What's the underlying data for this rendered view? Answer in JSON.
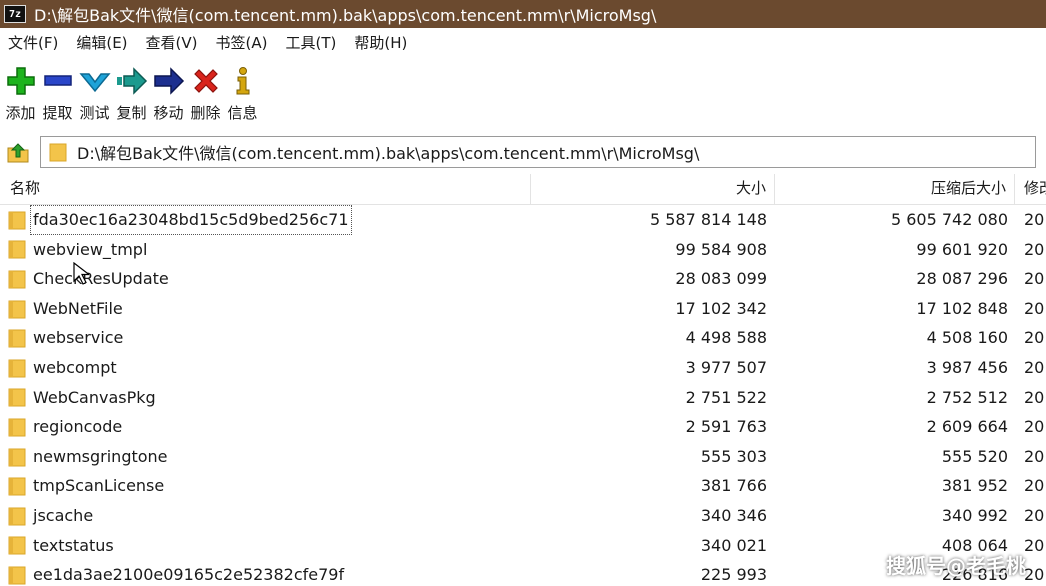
{
  "window": {
    "app_icon_text": "7z",
    "title": "D:\\解包Bak文件\\微信(com.tencent.mm).bak\\apps\\com.tencent.mm\\r\\MicroMsg\\"
  },
  "menu": [
    {
      "label": "文件(F)"
    },
    {
      "label": "编辑(E)"
    },
    {
      "label": "查看(V)"
    },
    {
      "label": "书签(A)"
    },
    {
      "label": "工具(T)"
    },
    {
      "label": "帮助(H)"
    }
  ],
  "toolbar": [
    {
      "label": "添加",
      "icon": "plus-icon",
      "color": "#1db31d"
    },
    {
      "label": "提取",
      "icon": "minus-icon",
      "color": "#2a46c9"
    },
    {
      "label": "测试",
      "icon": "check-icon",
      "color": "#1fa3d8"
    },
    {
      "label": "复制",
      "icon": "copy-arrow-icon",
      "color": "#1b9a8e"
    },
    {
      "label": "移动",
      "icon": "move-arrow-icon",
      "color": "#1c2f8f"
    },
    {
      "label": "删除",
      "icon": "delete-x-icon",
      "color": "#d9241c"
    },
    {
      "label": "信息",
      "icon": "info-icon",
      "color": "#d4a60f"
    }
  ],
  "address": {
    "path": "D:\\解包Bak文件\\微信(com.tencent.mm).bak\\apps\\com.tencent.mm\\r\\MicroMsg\\"
  },
  "columns": {
    "name": "名称",
    "size": "大小",
    "packed": "压缩后大小",
    "modified": "修改"
  },
  "rows": [
    {
      "name": "fda30ec16a23048bd15c5d9bed256c71",
      "size": "5 587 814 148",
      "packed": "5 605 742 080",
      "modified": "20"
    },
    {
      "name": "webview_tmpl",
      "size": "99 584 908",
      "packed": "99 601 920",
      "modified": "20"
    },
    {
      "name": "CheckResUpdate",
      "size": "28 083 099",
      "packed": "28 087 296",
      "modified": "20"
    },
    {
      "name": "WebNetFile",
      "size": "17 102 342",
      "packed": "17 102 848",
      "modified": "20"
    },
    {
      "name": "webservice",
      "size": "4 498 588",
      "packed": "4 508 160",
      "modified": "20"
    },
    {
      "name": "webcompt",
      "size": "3 977 507",
      "packed": "3 987 456",
      "modified": "20"
    },
    {
      "name": "WebCanvasPkg",
      "size": "2 751 522",
      "packed": "2 752 512",
      "modified": "20"
    },
    {
      "name": "regioncode",
      "size": "2 591 763",
      "packed": "2 609 664",
      "modified": "20"
    },
    {
      "name": "newmsgringtone",
      "size": "555 303",
      "packed": "555 520",
      "modified": "20"
    },
    {
      "name": "tmpScanLicense",
      "size": "381 766",
      "packed": "381 952",
      "modified": "20"
    },
    {
      "name": "jscache",
      "size": "340 346",
      "packed": "340 992",
      "modified": "20"
    },
    {
      "name": "textstatus",
      "size": "340 021",
      "packed": "408 064",
      "modified": "20"
    },
    {
      "name": "ee1da3ae2100e09165c2e52382cfe79f",
      "size": "225 993",
      "packed": "226 816",
      "modified": "20"
    }
  ],
  "watermark": "搜狐号@老毛桃",
  "colors": {
    "titlebar": "#6b4a2f",
    "folder": "#f3c44a"
  }
}
